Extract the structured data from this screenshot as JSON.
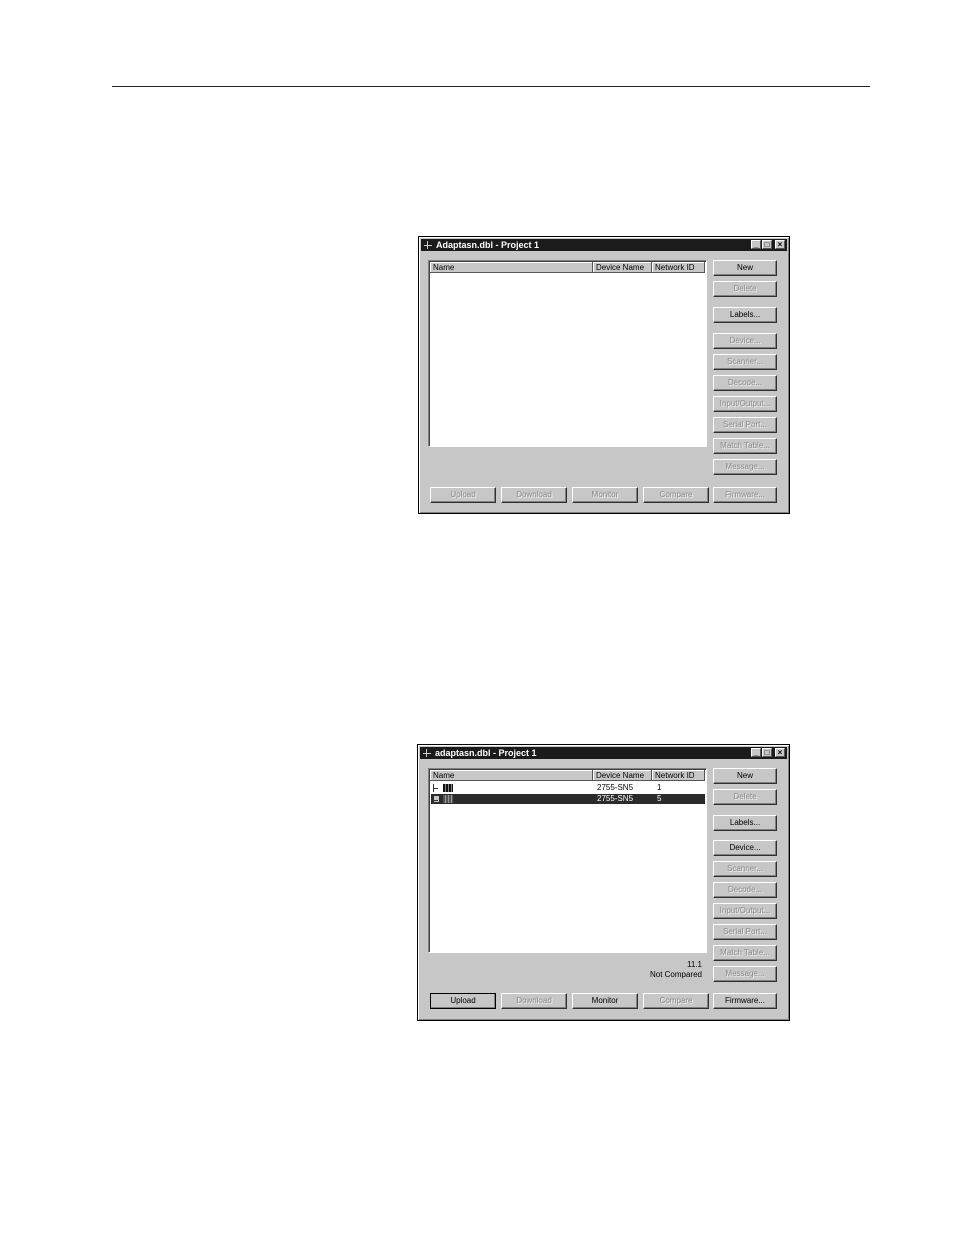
{
  "window1": {
    "title": "Adaptasn.dbl - Project 1",
    "columns": [
      "Name",
      "Device Name",
      "Network ID"
    ],
    "side_buttons": [
      {
        "label": "New",
        "enabled": true
      },
      {
        "label": "Delete",
        "enabled": false
      },
      {
        "label": "Labels...",
        "enabled": true
      },
      {
        "label": "Device...",
        "enabled": false
      },
      {
        "label": "Scanner...",
        "enabled": false
      },
      {
        "label": "Decode...",
        "enabled": false
      },
      {
        "label": "Input/Output...",
        "enabled": false
      },
      {
        "label": "Serial Port...",
        "enabled": false
      },
      {
        "label": "Match Table...",
        "enabled": false
      },
      {
        "label": "Message...",
        "enabled": false
      }
    ],
    "bottom_buttons": [
      {
        "label": "Upload",
        "enabled": false
      },
      {
        "label": "Download",
        "enabled": false
      },
      {
        "label": "Monitor",
        "enabled": false
      },
      {
        "label": "Compare",
        "enabled": false
      },
      {
        "label": "Firmware...",
        "enabled": false
      }
    ]
  },
  "window2": {
    "title": "adaptasn.dbl - Project 1",
    "columns": [
      "Name",
      "Device Name",
      "Network ID"
    ],
    "rows": [
      {
        "device_name": "2755-SN5",
        "network_id": "1",
        "selected": false
      },
      {
        "device_name": "2755-SN5",
        "network_id": "5",
        "selected": true
      }
    ],
    "status_line1": "11.1",
    "status_line2": "Not Compared",
    "side_buttons": [
      {
        "label": "New",
        "enabled": true
      },
      {
        "label": "Delete",
        "enabled": false
      },
      {
        "label": "Labels...",
        "enabled": true
      },
      {
        "label": "Device...",
        "enabled": true
      },
      {
        "label": "Scanner...",
        "enabled": false
      },
      {
        "label": "Decode...",
        "enabled": false
      },
      {
        "label": "Input/Output...",
        "enabled": false
      },
      {
        "label": "Serial Port...",
        "enabled": false
      },
      {
        "label": "Match Table...",
        "enabled": false
      },
      {
        "label": "Message...",
        "enabled": false
      }
    ],
    "bottom_buttons": [
      {
        "label": "Upload",
        "enabled": true
      },
      {
        "label": "Download",
        "enabled": false
      },
      {
        "label": "Monitor",
        "enabled": true
      },
      {
        "label": "Compare",
        "enabled": false
      },
      {
        "label": "Firmware...",
        "enabled": true
      }
    ]
  }
}
